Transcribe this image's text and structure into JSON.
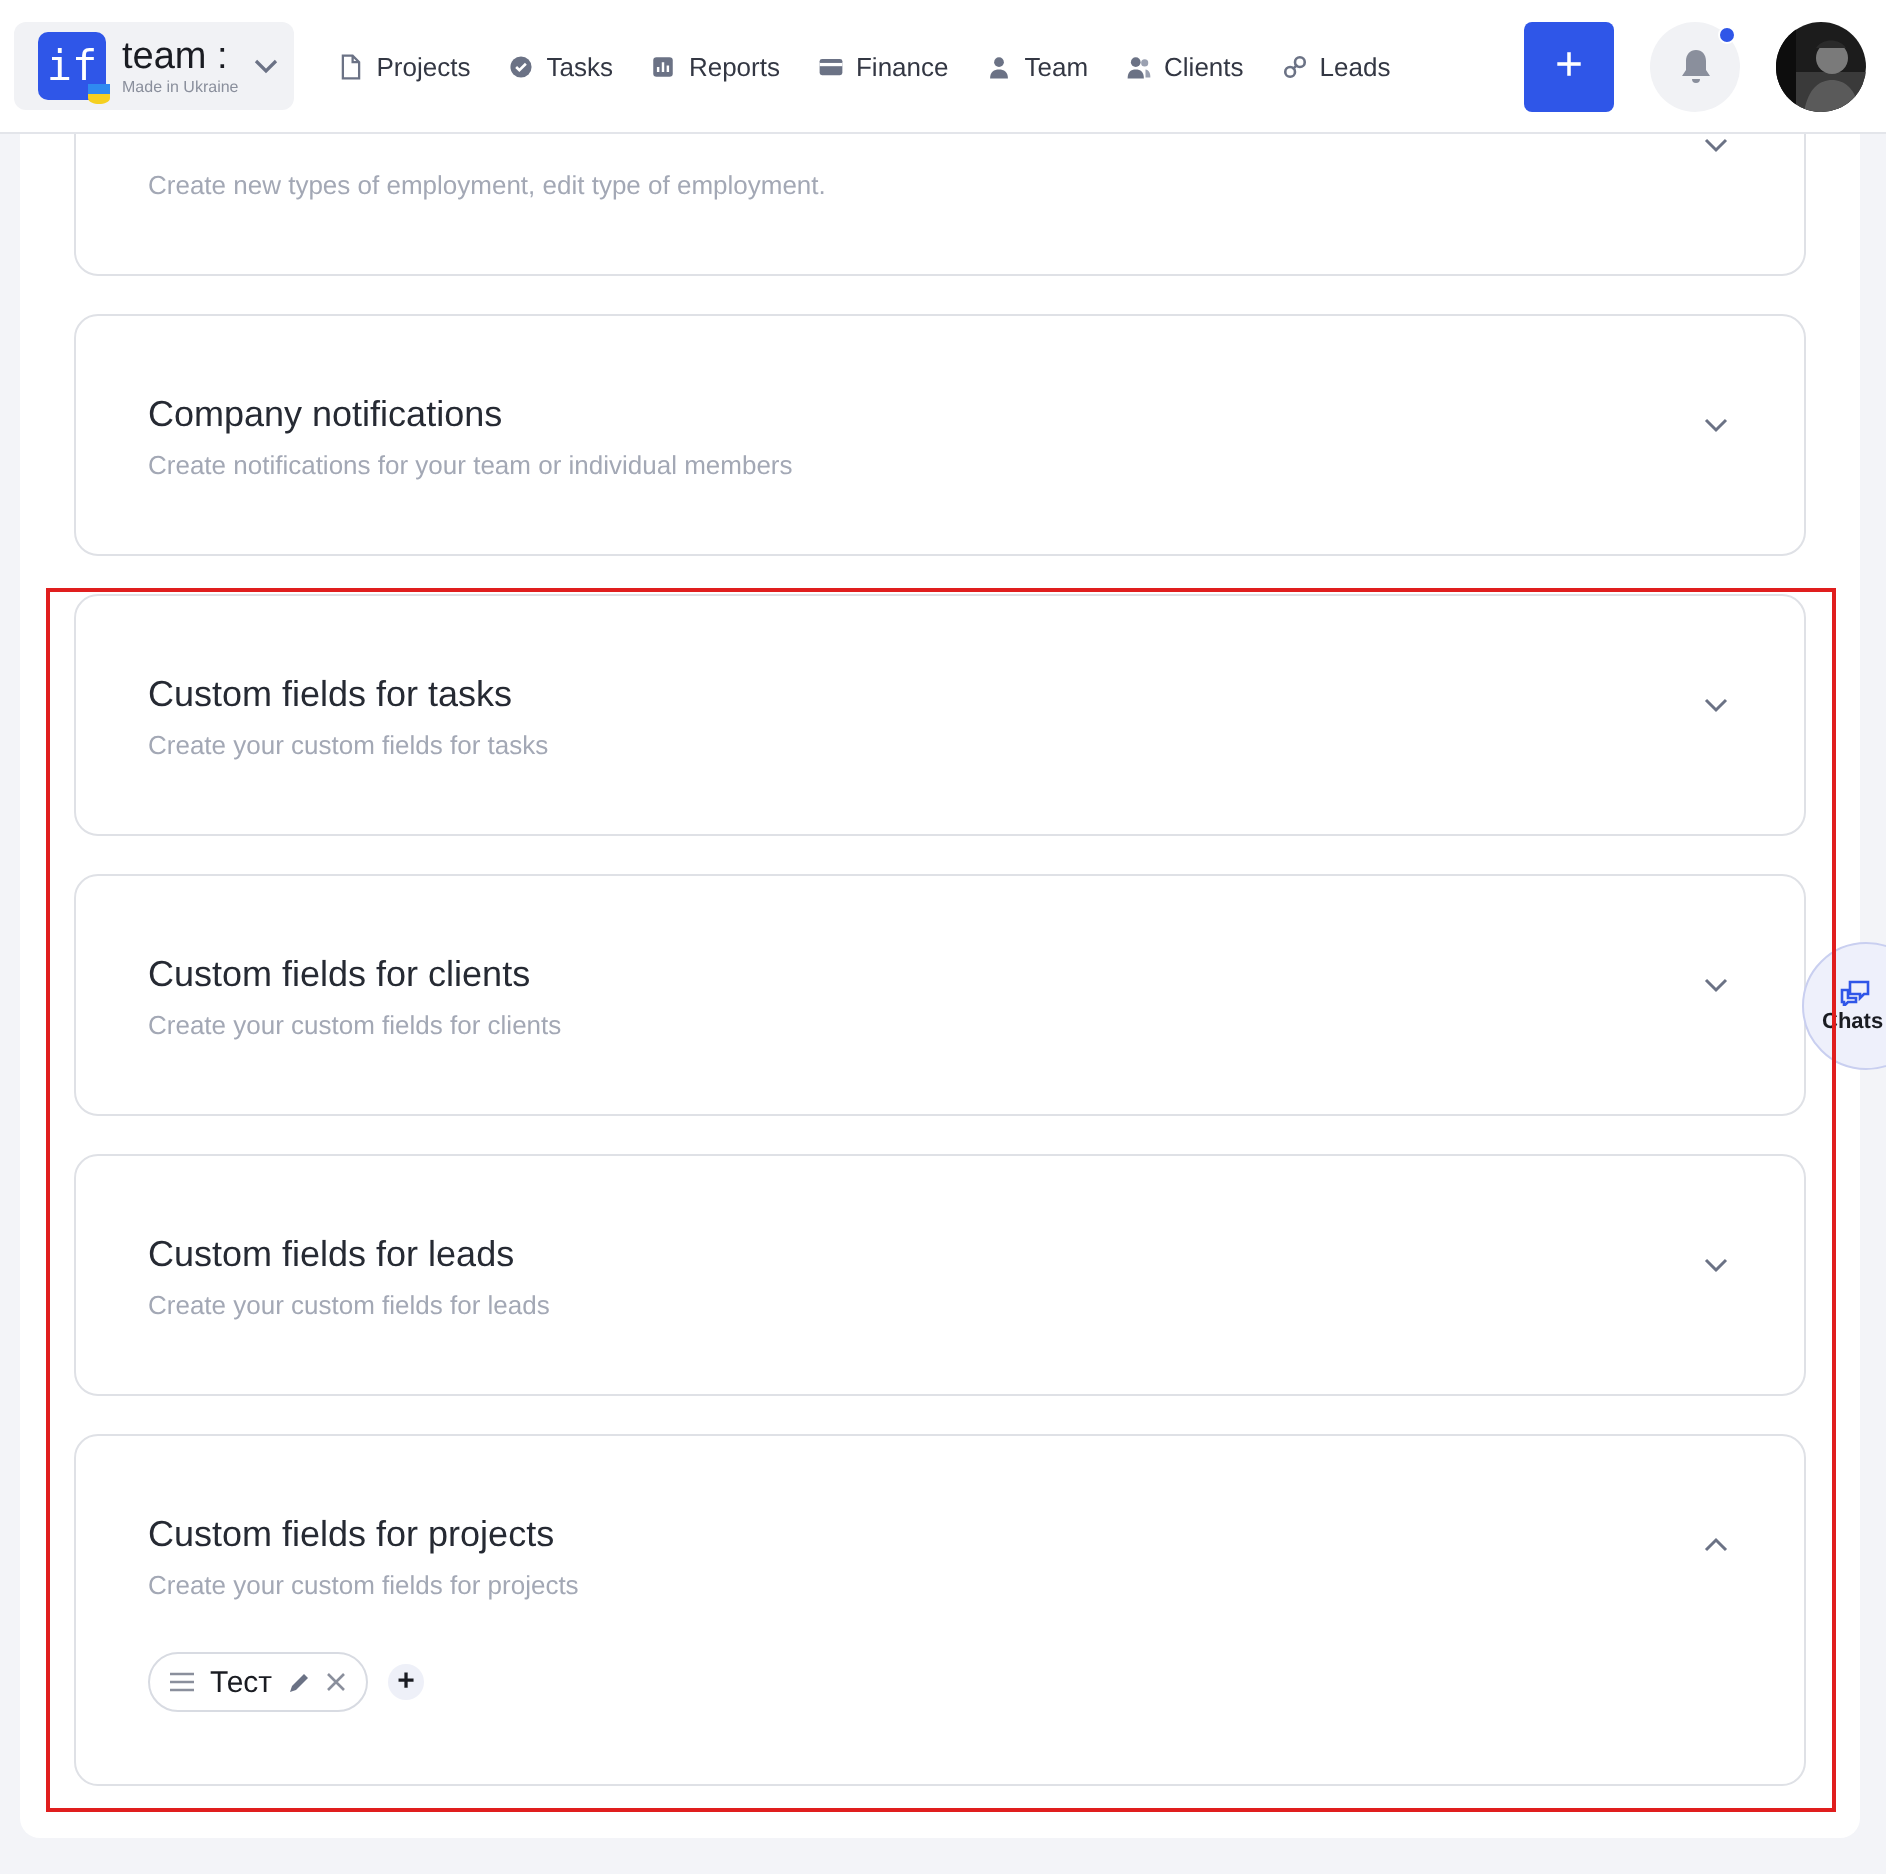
{
  "header": {
    "logo": {
      "mark": "if",
      "name": "team :",
      "tagline": "Made in Ukraine"
    },
    "nav": [
      {
        "label": "Projects"
      },
      {
        "label": "Tasks"
      },
      {
        "label": "Reports"
      },
      {
        "label": "Finance"
      },
      {
        "label": "Team"
      },
      {
        "label": "Clients"
      },
      {
        "label": "Leads"
      }
    ],
    "add_button": "+",
    "notifications": {
      "unread": true
    }
  },
  "sections": [
    {
      "description": "Create new types of employment, edit type of employment.",
      "expanded": false,
      "highlighted": false
    },
    {
      "title": "Company notifications",
      "description": "Create notifications for your team or individual members",
      "expanded": false,
      "highlighted": false
    },
    {
      "title": "Custom fields for tasks",
      "description": "Create your custom fields for tasks",
      "expanded": false,
      "highlighted": true
    },
    {
      "title": "Custom fields for clients",
      "description": "Create your custom fields for clients",
      "expanded": false,
      "highlighted": true
    },
    {
      "title": "Custom fields for leads",
      "description": "Create your custom fields for leads",
      "expanded": false,
      "highlighted": true
    },
    {
      "title": "Custom fields for projects",
      "description": "Create your custom fields for projects",
      "expanded": true,
      "highlighted": true,
      "fields": [
        {
          "name": "Тест"
        }
      ],
      "add_label": "+"
    }
  ],
  "chats": {
    "label": "Chats"
  }
}
